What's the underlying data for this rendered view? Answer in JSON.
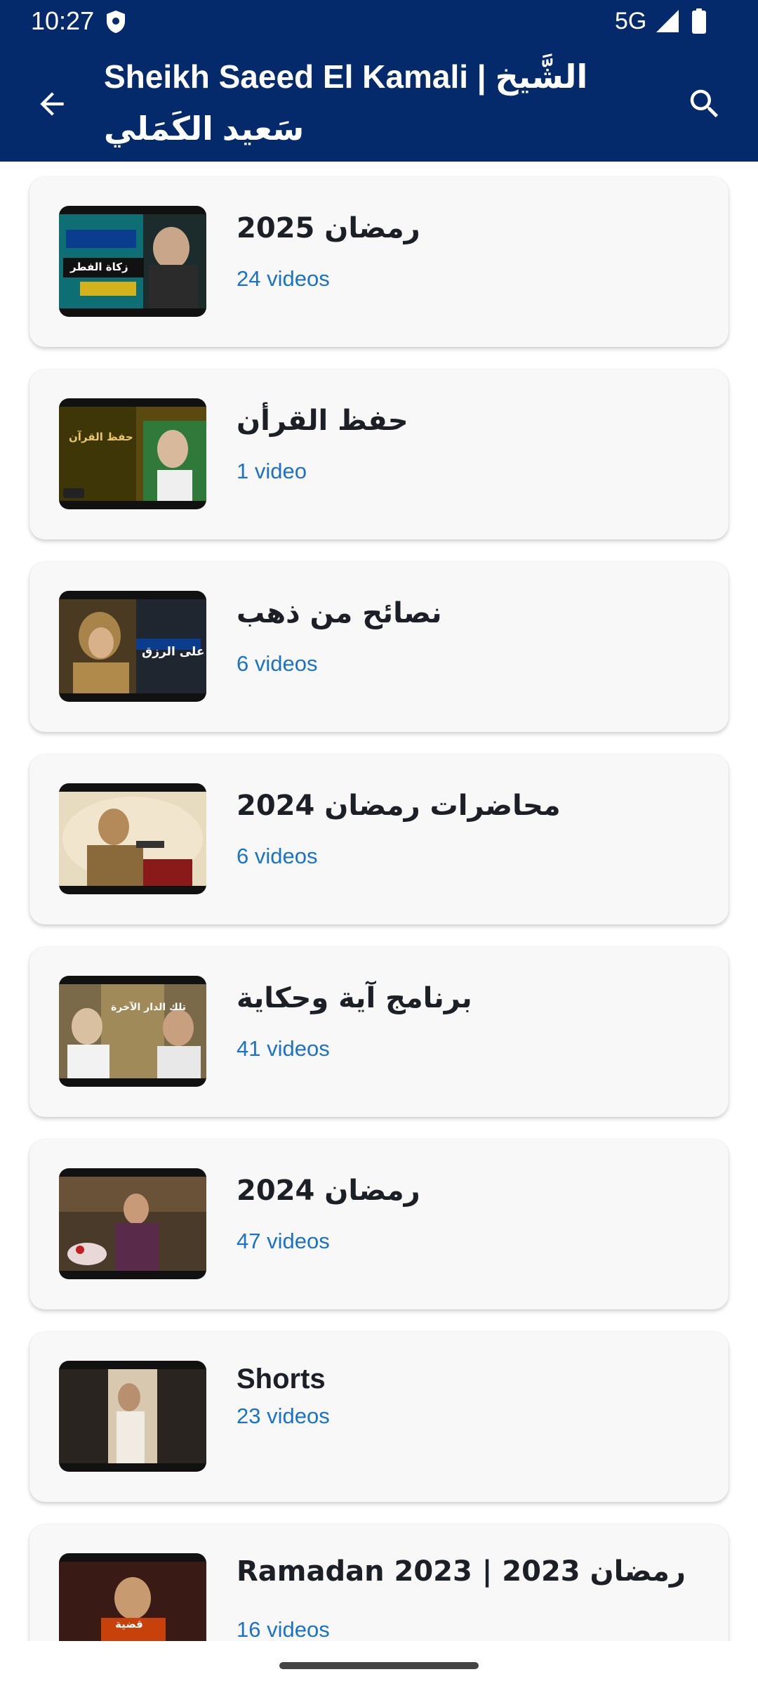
{
  "status_bar": {
    "time": "10:27",
    "network": "5G",
    "shield_icon": "shield-icon",
    "signal_icon": "signal-icon",
    "battery_icon": "battery-icon"
  },
  "app_bar": {
    "title": "Sheikh Saeed El Kamali | الشَّيخ سَعيد الكَمَلي",
    "back_icon": "arrow-back-icon",
    "search_icon": "search-icon"
  },
  "colors": {
    "app_bar_bg": "#042a6b",
    "count_text": "#1a73c8",
    "card_bg": "#f8f8f8"
  },
  "playlists": [
    {
      "title": "رمضان 2025",
      "count": "24 videos",
      "thumb_caption": "زكاة الفطر"
    },
    {
      "title": "حفظ القرأن",
      "count": "1 video",
      "thumb_caption": "حفظ القرآن"
    },
    {
      "title": "نصائح من ذهب",
      "count": "6 videos",
      "thumb_caption": "على الرزق"
    },
    {
      "title": "محاضرات رمضان 2024",
      "count": "6 videos",
      "thumb_caption": ""
    },
    {
      "title": "برنامج آية وحكاية",
      "count": "41 videos",
      "thumb_caption": "تلك الدار الآخرة"
    },
    {
      "title": "رمضان 2024",
      "count": "47 videos",
      "thumb_caption": ""
    },
    {
      "title": "Shorts",
      "count": "23 videos",
      "thumb_caption": ""
    },
    {
      "title": "Ramadan 2023 | رمضان 2023",
      "count": "16 videos",
      "thumb_caption": "قضية"
    }
  ]
}
